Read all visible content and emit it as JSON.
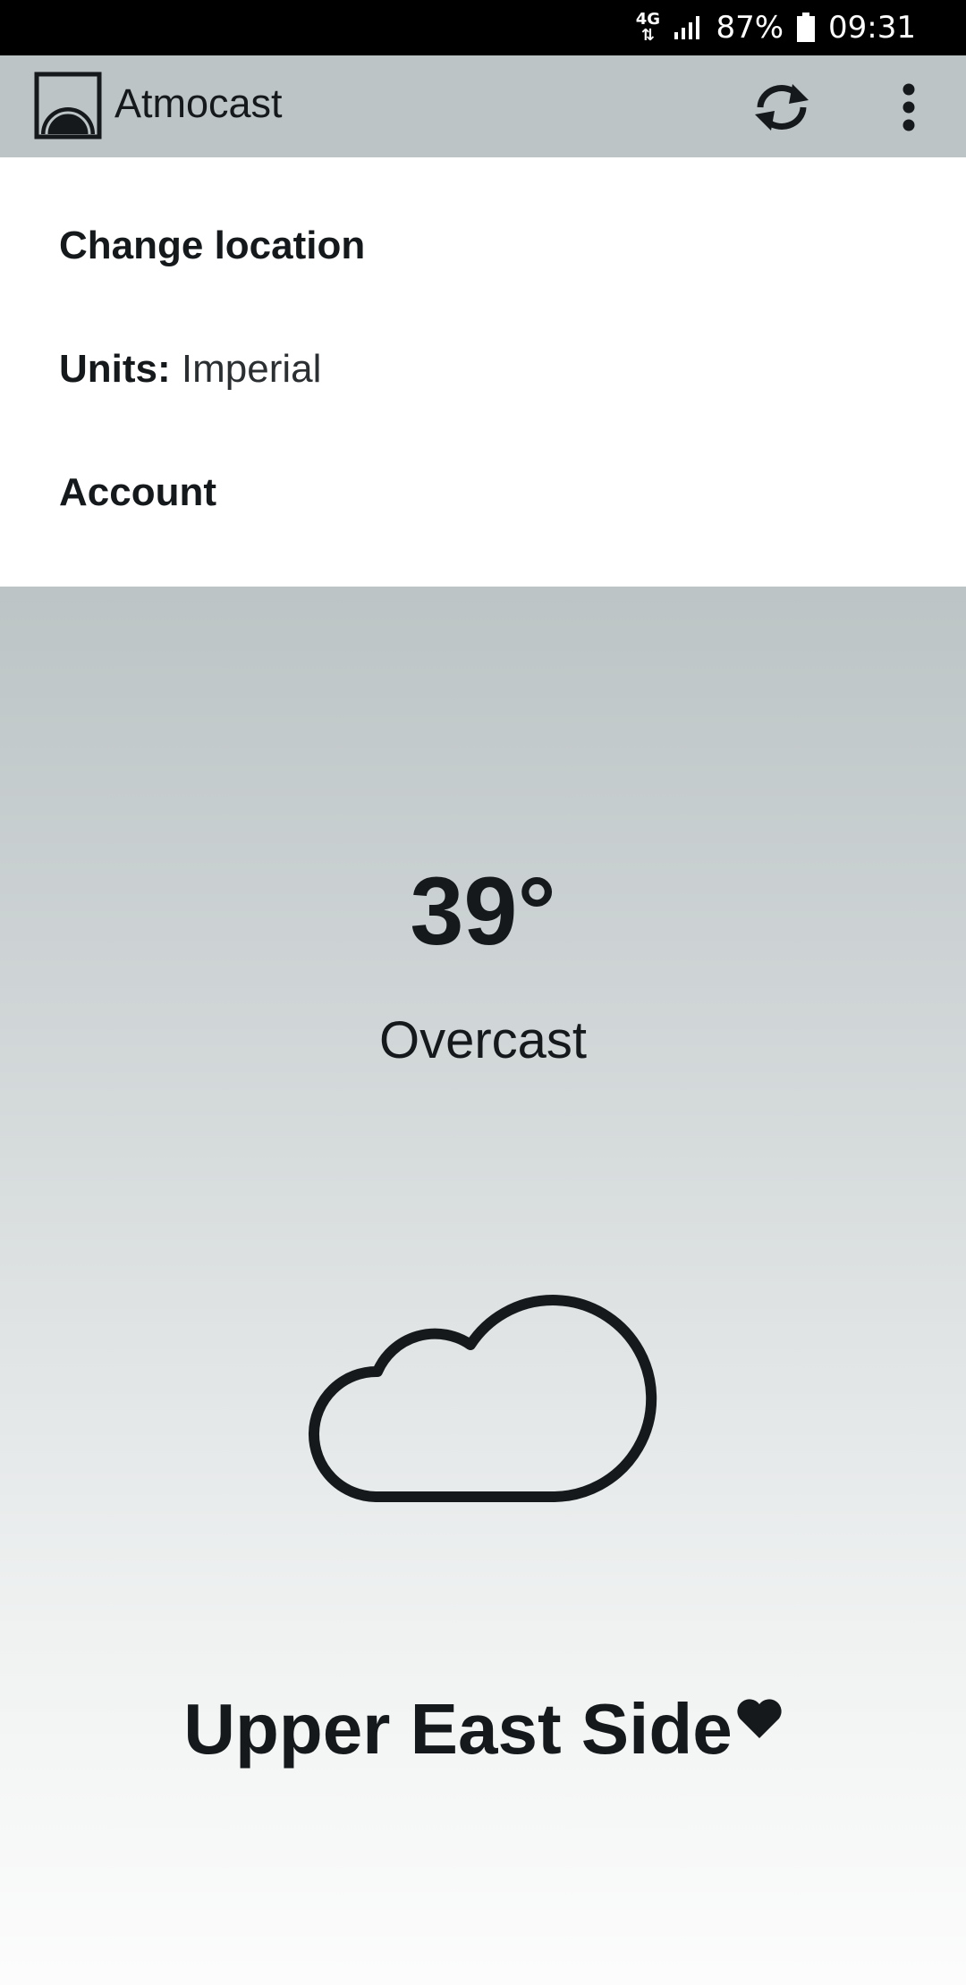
{
  "status_bar": {
    "network": "4G",
    "battery_percent": "87%",
    "time": "09:31",
    "icons": [
      "network-4g-icon",
      "signal-icon",
      "battery-icon"
    ]
  },
  "app_bar": {
    "title": "Atmocast",
    "icons": [
      "app-logo-icon",
      "refresh-icon",
      "more-vert-icon"
    ]
  },
  "settings": {
    "change_location": "Change location",
    "units_label": "Units:",
    "units_value": "Imperial",
    "account": "Account"
  },
  "weather": {
    "temperature": "39°",
    "condition": "Overcast",
    "condition_icon": "cloud-icon",
    "location": "Upper East Side",
    "favorite_icon": "heart-icon"
  },
  "colors": {
    "app_bar_bg": "#bcc4c5",
    "text": "#15191b",
    "status_bar_bg": "#000000"
  }
}
